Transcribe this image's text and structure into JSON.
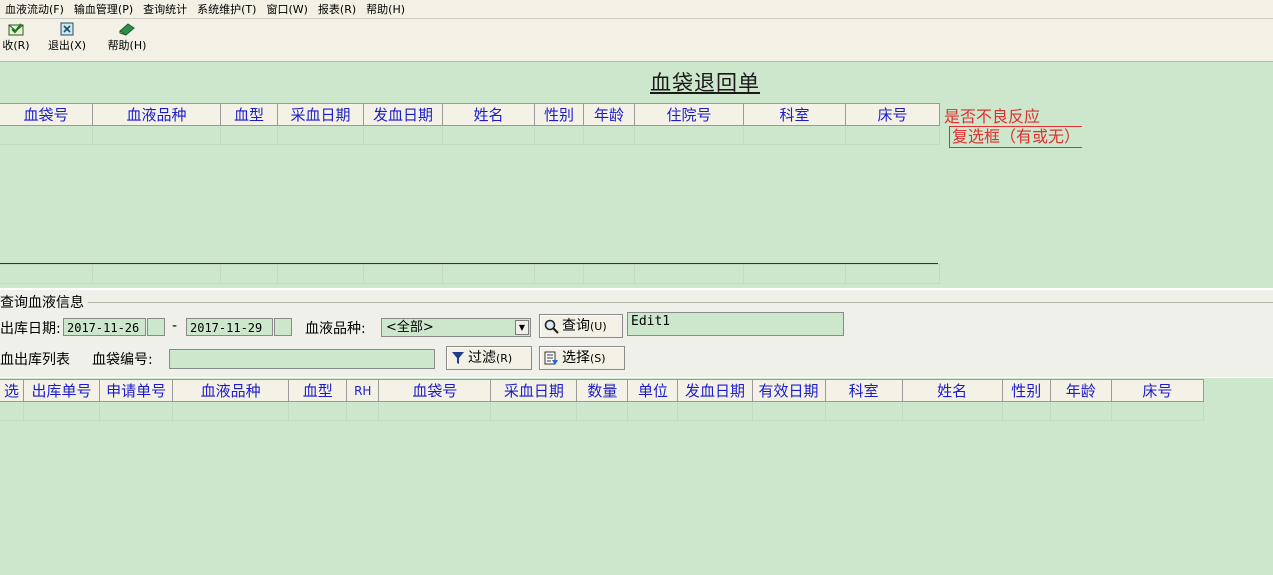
{
  "menu": [
    "血液流动(F)",
    "输血管理(P)",
    "查询统计",
    "系统维护(T)",
    "窗口(W)",
    "报表(R)",
    "帮助(H)"
  ],
  "toolbar": {
    "receive_label": "收(R)",
    "exit_label": "退出(X)",
    "help_label": "帮助(H)"
  },
  "upper": {
    "title": "血袋退回单",
    "columns": [
      "血袋号",
      "血液品种",
      "血型",
      "采血日期",
      "发血日期",
      "姓名",
      "性别",
      "年龄",
      "住院号",
      "科室",
      "床号"
    ],
    "note1": "是否不良反应",
    "note2": "复选框（有或无）"
  },
  "query": {
    "group_title": "查询血液信息",
    "date_label": "出库日期:",
    "date_from": "2017-11-26",
    "dash": "-",
    "date_to": "2017-11-29",
    "variety_label": "血液品种:",
    "variety_value": "<全部>",
    "query_button": "查询",
    "query_hotkey": "(U)",
    "edit_text": "Edit1",
    "list_label": "血出库列表",
    "bag_label": "血袋编号:",
    "bag_value": "",
    "filter_button": "过滤",
    "filter_hotkey": "(R)",
    "select_button": "选择",
    "select_hotkey": "(S)"
  },
  "lower": {
    "columns": [
      "选",
      "出库单号",
      "申请单号",
      "血液品种",
      "血型",
      "RH",
      "血袋号",
      "采血日期",
      "数量",
      "单位",
      "发血日期",
      "有效日期",
      "科室",
      "姓名",
      "性别",
      "年龄",
      "床号"
    ]
  },
  "colors": {
    "grid_bg": "#cde7cc",
    "header_text": "#1c1ccc",
    "note_red": "#e03030",
    "panel": "#f0f0ea"
  }
}
